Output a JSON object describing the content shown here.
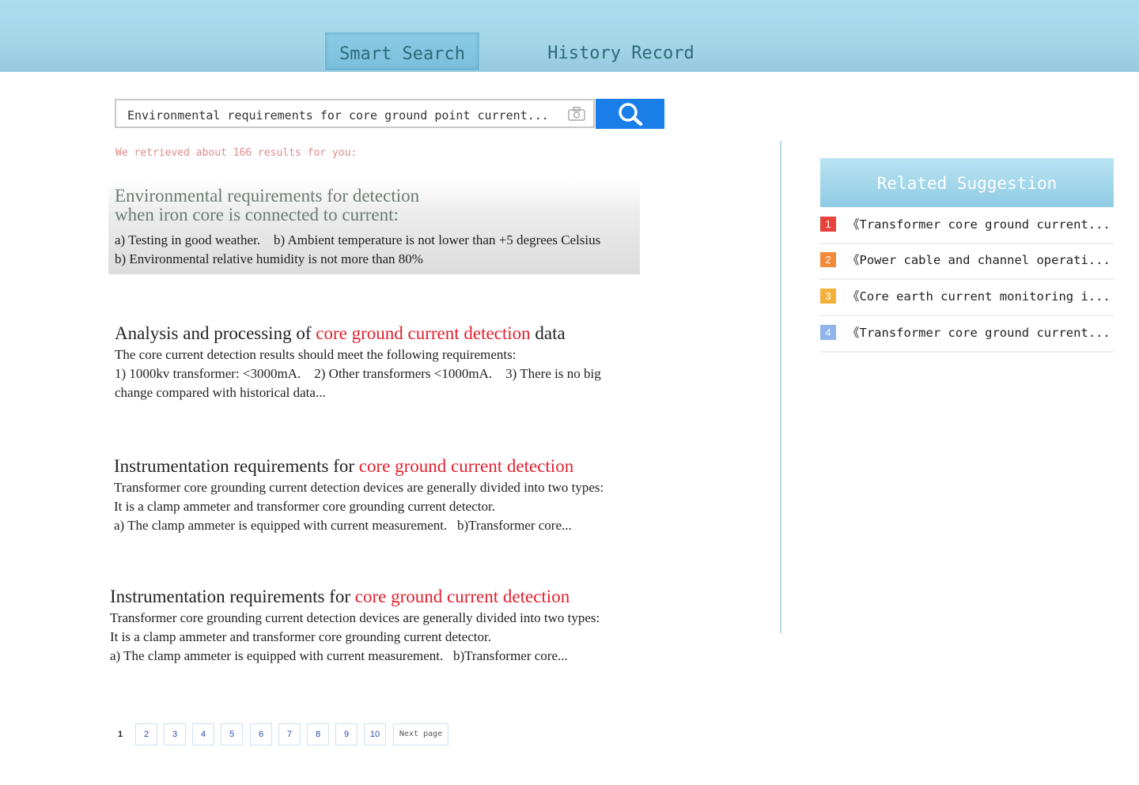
{
  "header": {
    "tabs": [
      {
        "label": "Smart Search",
        "active": true
      },
      {
        "label": "History Record",
        "active": false
      }
    ]
  },
  "search": {
    "value": "Environmental requirements for core ground point current...",
    "camera_icon": "camera-icon",
    "search_icon": "magnifier-icon"
  },
  "result_count": "We retrieved about 166 results for you:",
  "results": [
    {
      "title_line1": "Environmental requirements for detection",
      "title_line2": "when iron core is connected to current:",
      "body_line1": "a) Testing in good weather.    b) Ambient temperature is not lower than +5 degrees Celsius",
      "body_line2": "b) Environmental relative humidity is not more than 80%"
    },
    {
      "title_pre": "Analysis and processing of ",
      "title_hl": "core ground current detection",
      "title_post": " data",
      "body_line1": "The core current detection results should meet the following requirements:",
      "body_line2": "1) 1000kv transformer: <3000mA.    2) Other transformers <1000mA.    3) There is no big",
      "body_line3": "change compared with historical data..."
    },
    {
      "title_pre": "Instrumentation requirements for ",
      "title_hl": "core ground current detection",
      "body_line1": "Transformer core grounding current detection devices are generally divided into two types:",
      "body_line2": "It is a clamp ammeter and transformer core grounding current detector.",
      "body_line3": "a) The clamp ammeter is equipped with current measurement.   b)Transformer core..."
    },
    {
      "title_pre": "Instrumentation requirements for ",
      "title_hl": "core ground current detection",
      "body_line1": "Transformer core grounding current detection devices are generally divided into two types:",
      "body_line2": "It is a clamp ammeter and transformer core grounding current detector.",
      "body_line3": "a) The clamp ammeter is equipped with current measurement.   b)Transformer core..."
    }
  ],
  "suggestions": {
    "title": "Related Suggestion",
    "items": [
      {
        "num": "1",
        "color": "#e8423c",
        "text": "《Transformer core ground current..."
      },
      {
        "num": "2",
        "color": "#f28a3a",
        "text": "《Power cable and channel operati..."
      },
      {
        "num": "3",
        "color": "#f5b03a",
        "text": "《Core earth current monitoring i..."
      },
      {
        "num": "4",
        "color": "#8fb3ea",
        "text": "《Transformer core ground current..."
      }
    ]
  },
  "pagination": {
    "current": "1",
    "pages": [
      "2",
      "3",
      "4",
      "5",
      "6",
      "7",
      "8",
      "9",
      "10"
    ],
    "next_label": "Next page"
  },
  "colors": {
    "accent_blue": "#1a7ee9",
    "highlight_red": "#e0202f"
  }
}
